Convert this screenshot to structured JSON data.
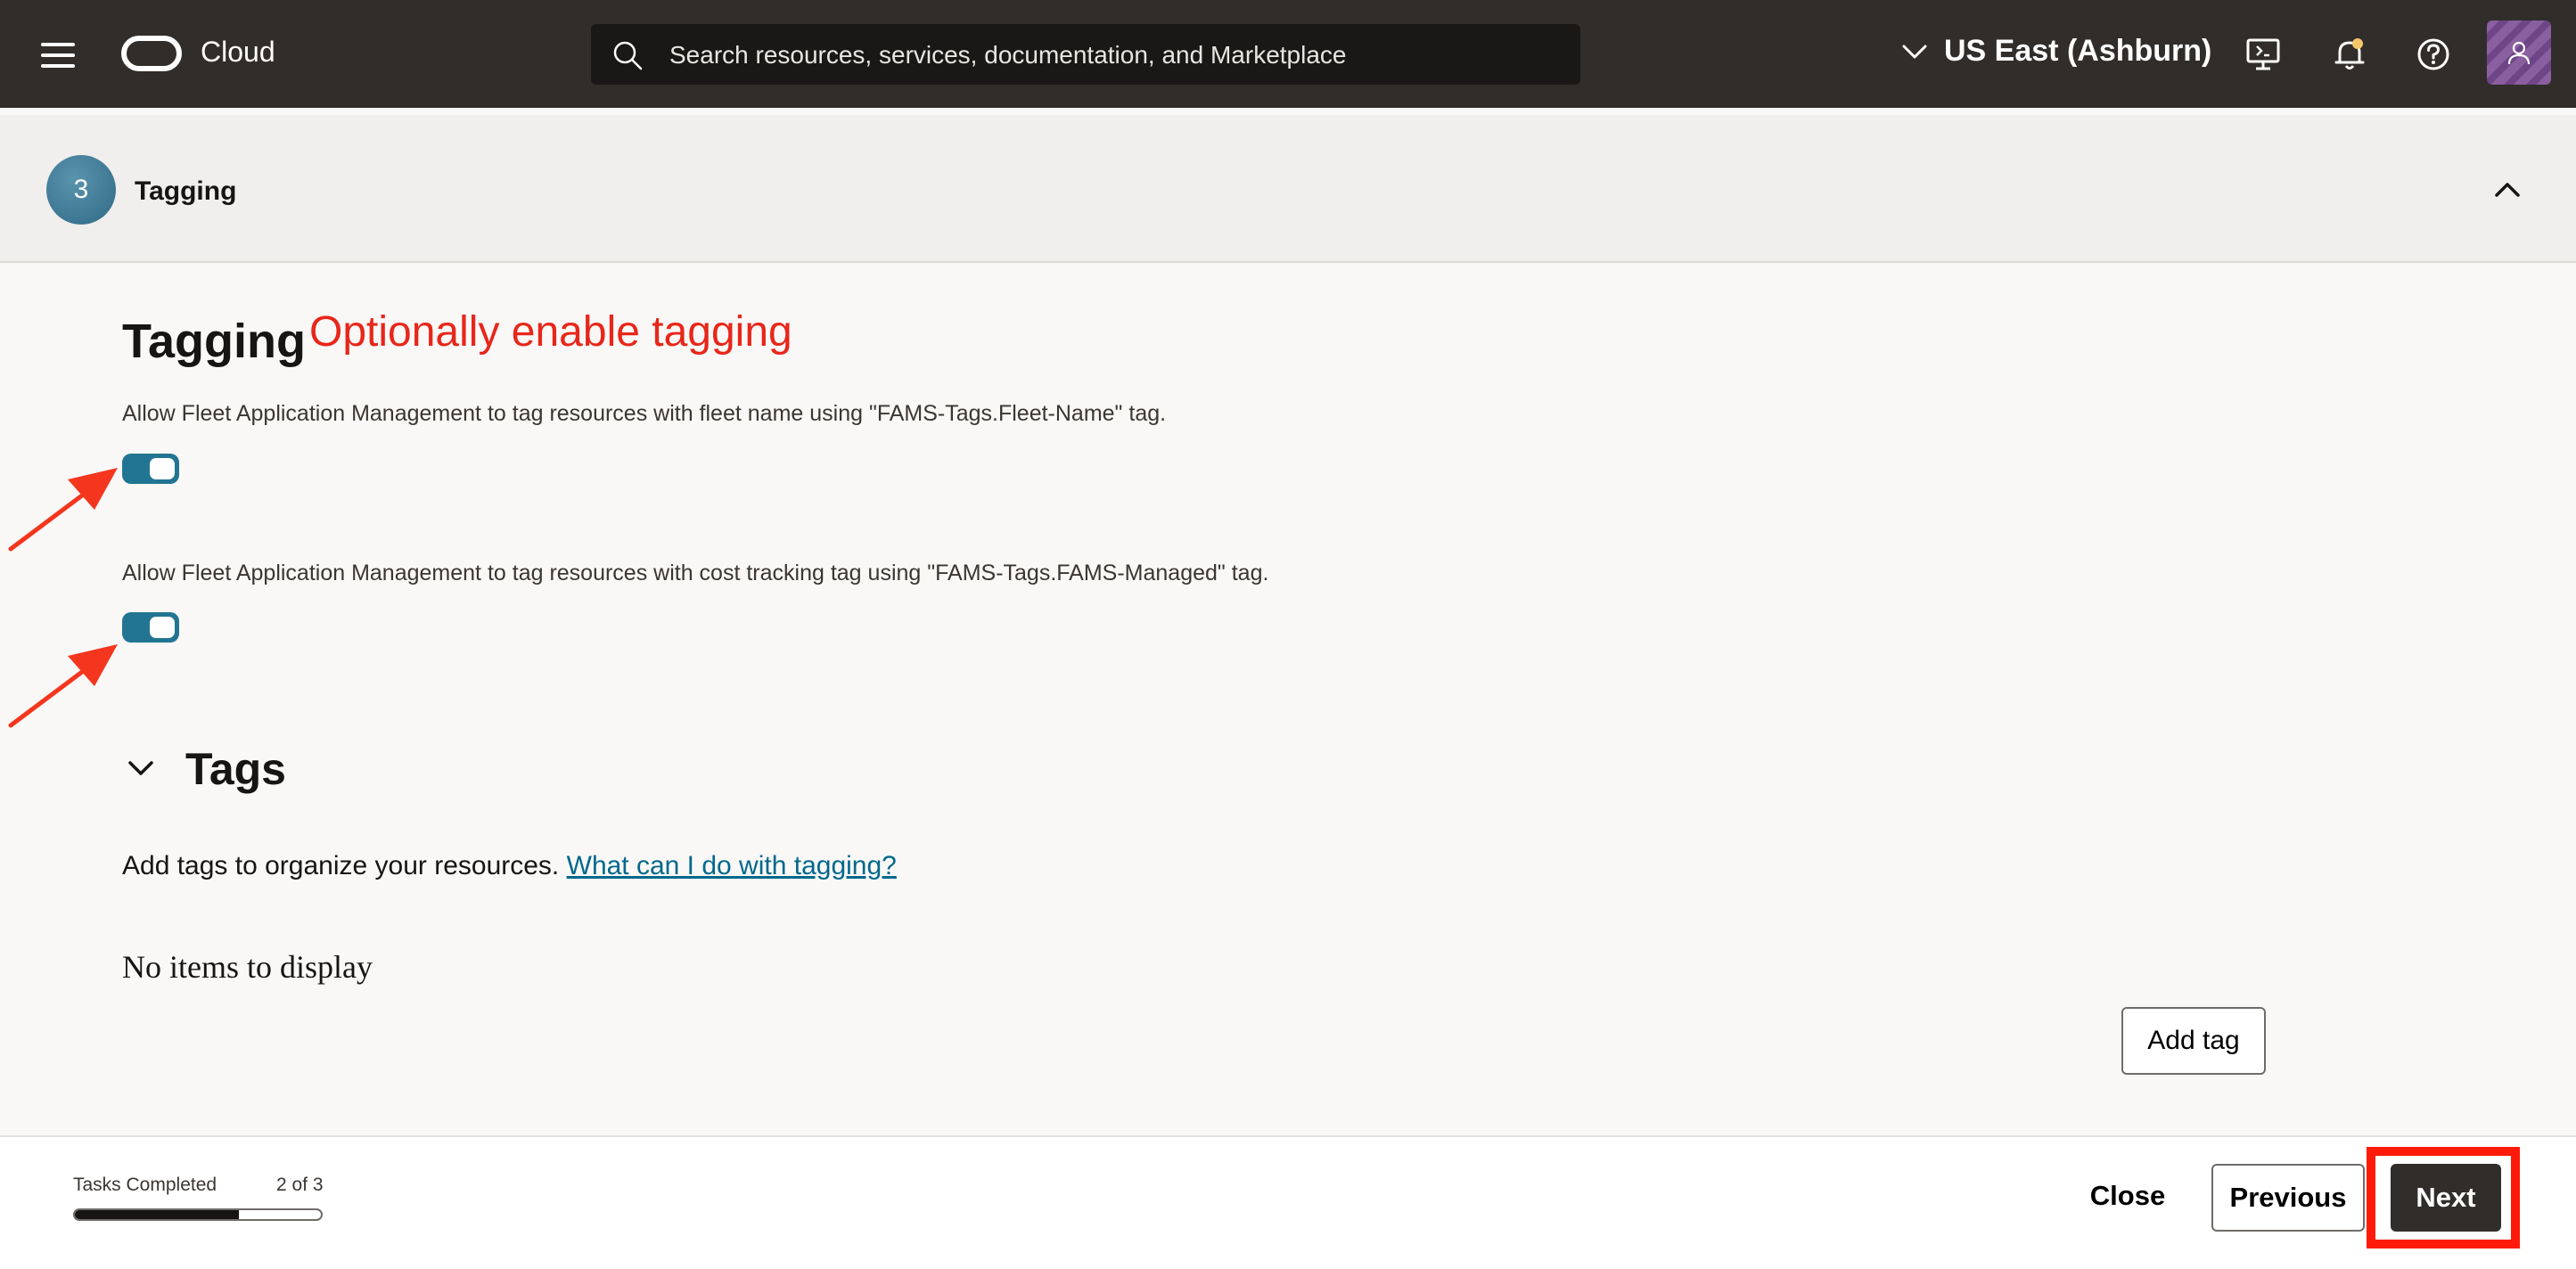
{
  "header": {
    "brand": "Cloud",
    "search_placeholder": "Search resources, services, documentation, and Marketplace",
    "region": "US East (Ashburn)",
    "icons": [
      "menu-icon",
      "oracle-logo",
      "search-icon",
      "chevron-down-icon",
      "cloud-shell-icon",
      "bell-icon",
      "help-icon",
      "user-avatar"
    ]
  },
  "step": {
    "number": "3",
    "title": "Tagging"
  },
  "tagging": {
    "title": "Tagging",
    "annotation": "Optionally enable tagging",
    "toggles": [
      {
        "label": "Allow Fleet Application Management to tag resources with fleet name using \"FAMS-Tags.Fleet-Name\" tag.",
        "enabled": true
      },
      {
        "label": "Allow Fleet Application Management to tag resources with cost tracking tag using \"FAMS-Tags.FAMS-Managed\" tag.",
        "enabled": true
      }
    ]
  },
  "tags": {
    "title": "Tags",
    "help_text": "Add tags to organize your resources.",
    "help_link": "What can I do with tagging?",
    "empty_text": "No items to display",
    "add_button": "Add tag"
  },
  "footer": {
    "tasks_label": "Tasks Completed",
    "tasks_count": "2 of 3",
    "progress": 0.667,
    "close_label": "Close",
    "previous_label": "Previous",
    "next_label": "Next"
  },
  "colors": {
    "annotation": "#e8261a",
    "toggle_on": "#227592",
    "highlight": "#ff1a0a"
  }
}
